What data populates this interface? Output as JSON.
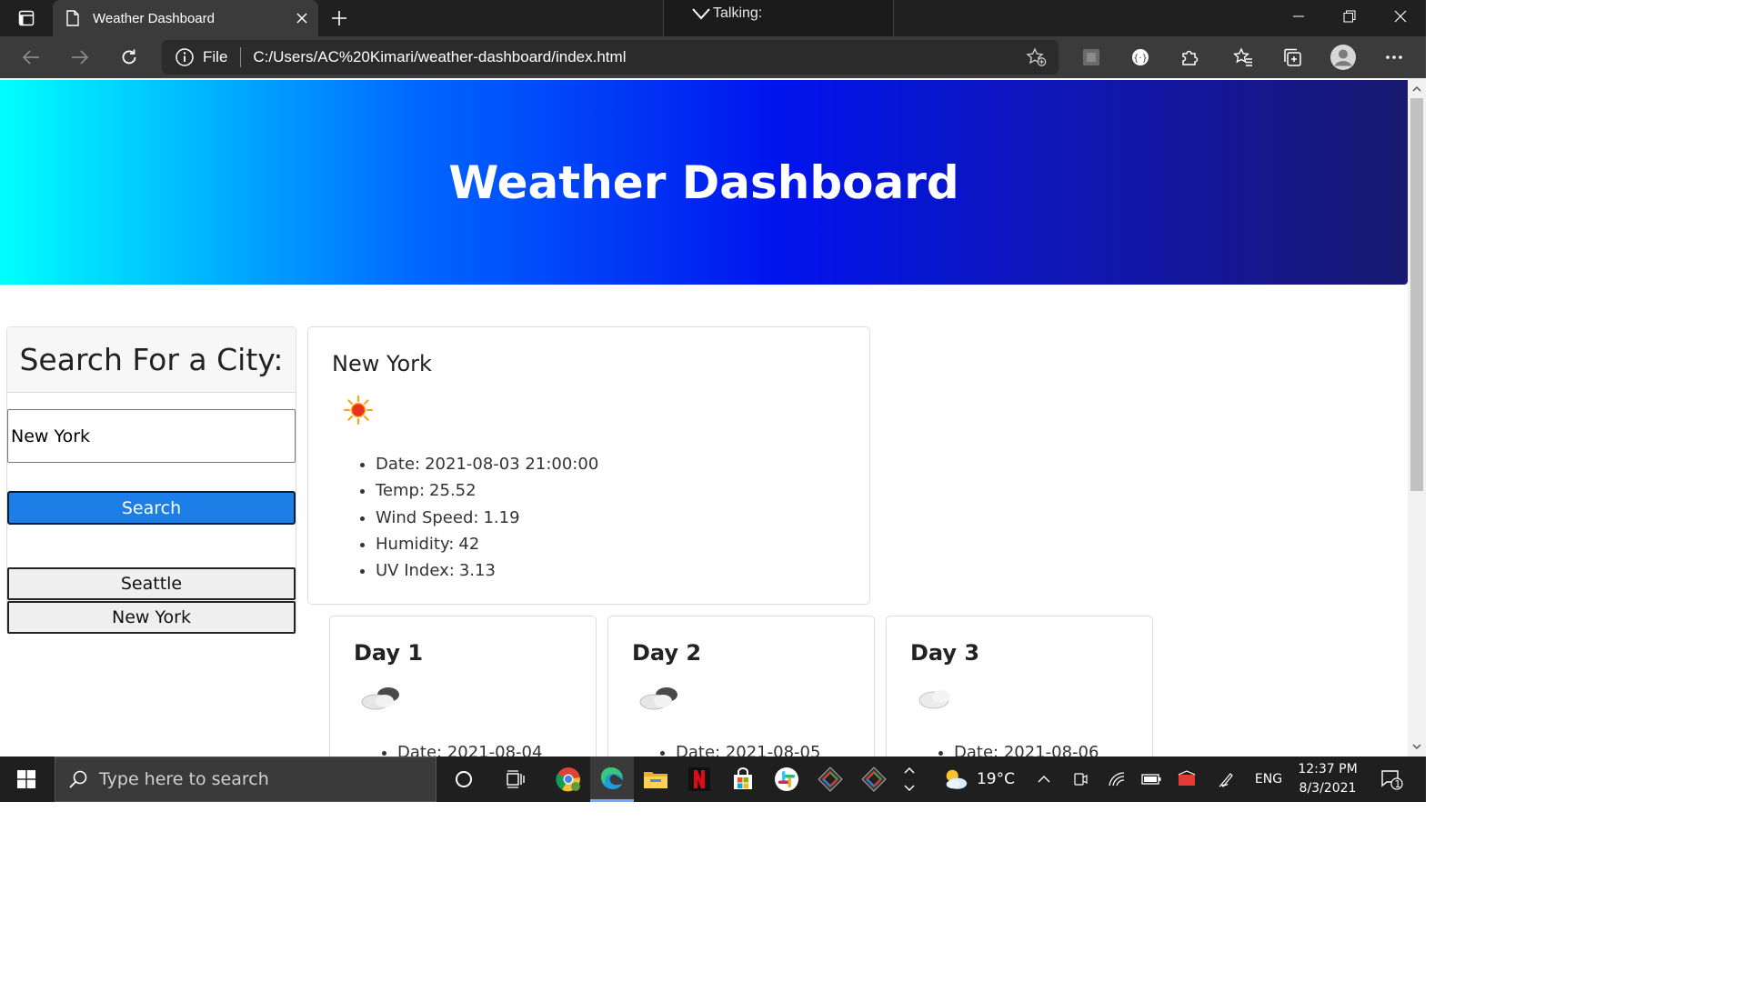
{
  "browser": {
    "tab_title": "Weather Dashboard",
    "talking_label": "Talking:",
    "file_label": "File",
    "url": "C:/Users/AC%20Kimari/weather-dashboard/index.html"
  },
  "page": {
    "hero_title": "Weather Dashboard",
    "search": {
      "heading": "Search For a City:",
      "input_value": "New York",
      "button_label": "Search",
      "history": [
        "Seattle",
        "New York"
      ]
    },
    "current": {
      "city": "New York",
      "icon": "sun-icon",
      "details": [
        {
          "label": "Date:",
          "value": "2021-08-03 21:00:00"
        },
        {
          "label": "Temp:",
          "value": "25.52"
        },
        {
          "label": "Wind Speed:",
          "value": "1.19"
        },
        {
          "label": "Humidity:",
          "value": "42"
        },
        {
          "label": "UV Index:",
          "value": "3.13"
        }
      ]
    },
    "forecast": [
      {
        "title": "Day 1",
        "icon": "cloud-icon",
        "date_label": "Date:",
        "date": "2021-08-04"
      },
      {
        "title": "Day 2",
        "icon": "cloud-icon",
        "date_label": "Date:",
        "date": "2021-08-05"
      },
      {
        "title": "Day 3",
        "icon": "cloud-icon",
        "date_label": "Date:",
        "date": "2021-08-06"
      }
    ]
  },
  "taskbar": {
    "search_placeholder": "Type here to search",
    "weather_temp": "19°C",
    "language": "ENG",
    "time": "12:37 PM",
    "date": "8/3/2021",
    "notification_count": "1"
  },
  "colors": {
    "hero_gradient_start": "#00ffff",
    "hero_gradient_end": "#191970",
    "search_button": "#1e7ee8",
    "chrome_dark": "#202020",
    "toolbar": "#3b3b3b"
  }
}
